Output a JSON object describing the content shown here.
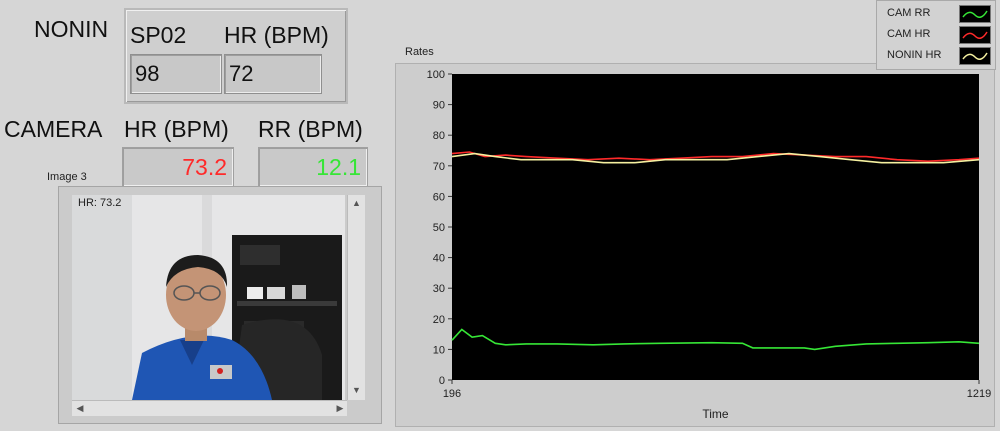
{
  "nonin": {
    "title": "NONIN",
    "spo2_label": "SP02",
    "hr_label": "HR (BPM)",
    "spo2_value": "98",
    "hr_value": "72"
  },
  "camera": {
    "title": "CAMERA",
    "hr_label": "HR (BPM)",
    "rr_label": "RR (BPM)",
    "hr_value": "73.2",
    "rr_value": "12.1",
    "hr_color": "#ff2a2a",
    "rr_color": "#36e636"
  },
  "image_panel": {
    "label": "Image 3",
    "overlay": "HR: 73.2"
  },
  "legend": {
    "items": [
      {
        "label": "CAM RR",
        "color": "#36e636",
        "icon": "green-line-icon"
      },
      {
        "label": "CAM HR",
        "color": "#ff2a2a",
        "icon": "red-line-icon"
      },
      {
        "label": "NONIN HR",
        "color": "#f5f0a0",
        "icon": "yellow-line-icon"
      }
    ]
  },
  "chart_data": {
    "type": "line",
    "title": "Rates",
    "xlabel": "Time",
    "ylabel": "",
    "xlim": [
      196,
      1219
    ],
    "ylim": [
      0,
      100
    ],
    "x_ticks": [
      "196",
      "1219"
    ],
    "y_ticks": [
      "0",
      "10",
      "20",
      "30",
      "40",
      "50",
      "60",
      "70",
      "80",
      "90",
      "100"
    ],
    "legend_position": "top-right",
    "grid": false,
    "series": [
      {
        "name": "CAM RR",
        "color": "#36e636",
        "x": [
          196,
          215,
          235,
          255,
          280,
          300,
          340,
          400,
          470,
          530,
          600,
          700,
          760,
          780,
          820,
          880,
          900,
          940,
          1000,
          1060,
          1120,
          1180,
          1219
        ],
        "y": [
          13,
          16.5,
          14,
          14.5,
          12,
          11.5,
          11.8,
          11.8,
          11.5,
          11.8,
          12,
          12.2,
          12,
          10.5,
          10.5,
          10.5,
          10,
          11,
          11.8,
          12,
          12.2,
          12.5,
          12
        ]
      },
      {
        "name": "CAM HR",
        "color": "#ff2a2a",
        "x": [
          196,
          230,
          260,
          300,
          340,
          400,
          460,
          520,
          580,
          640,
          700,
          760,
          820,
          880,
          940,
          1000,
          1060,
          1120,
          1180,
          1219
        ],
        "y": [
          74,
          74.5,
          73,
          73.5,
          73,
          72.5,
          72,
          72.5,
          72,
          72.5,
          73,
          73,
          74,
          73.5,
          73,
          73,
          72,
          71.5,
          72,
          72.5
        ]
      },
      {
        "name": "NONIN HR",
        "color": "#f5f0a0",
        "x": [
          196,
          240,
          280,
          330,
          380,
          430,
          490,
          550,
          610,
          670,
          730,
          790,
          850,
          910,
          970,
          1030,
          1090,
          1150,
          1219
        ],
        "y": [
          73,
          74,
          73,
          72,
          72,
          72,
          71,
          71,
          72,
          72,
          72,
          73,
          74,
          73,
          72,
          71,
          71,
          71,
          72
        ]
      }
    ]
  }
}
